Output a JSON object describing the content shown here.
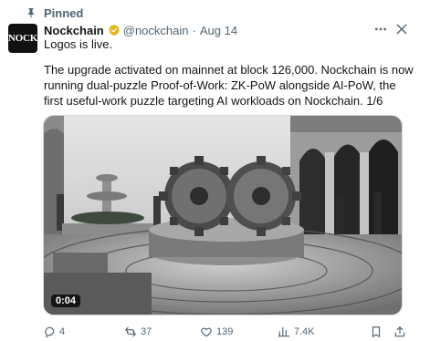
{
  "pinned": {
    "label": "Pinned",
    "icon": "pin-icon"
  },
  "author": {
    "avatar_text": "NOCK",
    "name": "Nockchain",
    "handle": "@nockchain",
    "separator": "·",
    "date": "Aug 14",
    "verified_color": "#e2b719"
  },
  "post": {
    "line1": "Logos is live.",
    "line2": "The upgrade activated on mainnet at block 126,000. Nockchain is now running dual-puzzle Proof-of-Work: ZK-PoW alongside AI-PoW, the first useful-work puzzle targeting AI workloads on Nockchain. 1/6"
  },
  "media": {
    "duration": "0:04",
    "type": "video"
  },
  "actions": {
    "replies": "4",
    "reposts": "37",
    "likes": "139",
    "views": "7.4K"
  },
  "icons": {
    "more": "more-icon",
    "close": "close-icon",
    "reply": "reply-icon",
    "repost": "repost-icon",
    "like": "heart-icon",
    "views": "views-icon",
    "bookmark": "bookmark-icon",
    "share": "share-icon"
  },
  "colors": {
    "secondary_text": "#536471",
    "primary_text": "#0f1419"
  }
}
